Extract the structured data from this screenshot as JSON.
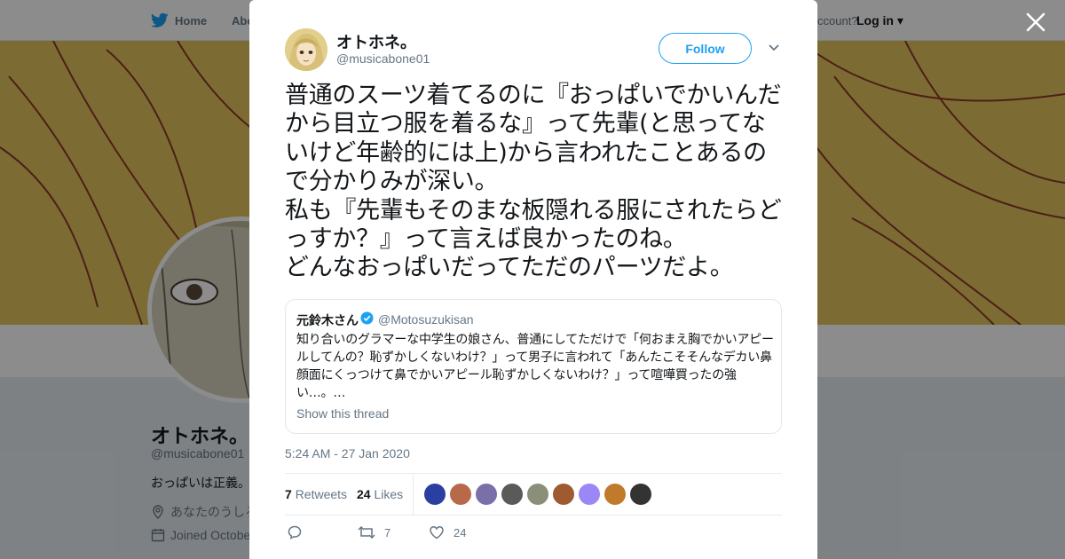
{
  "background_page": {
    "nav": {
      "home": "Home",
      "about": "Abo",
      "account_prompt": "ccount?",
      "login": "Log in"
    },
    "profile": {
      "name": "オトホネ。",
      "handle": "@musicabone01",
      "bio": "おっぱいは正義。",
      "location": "あなたのうしろ",
      "joined": "Joined Octobe"
    }
  },
  "tweet": {
    "author_name": "オトホネ。",
    "author_handle": "@musicabone01",
    "follow_label": "Follow",
    "text": "普通のスーツ着てるのに『おっぱいでかいんだから目立つ服を着るな』って先輩(と思ってないけど年齢的には上)から言われたことあるので分かりみが深い。\n私も『先輩もそのまな板隠れる服にされたらどっすか？』って言えば良かったのね。\nどんなおっぱいだってただのパーツだよ。",
    "quote": {
      "name": "元鈴木さん",
      "handle": "@Motosuzukisan",
      "text": "知り合いのグラマーな中学生の娘さん、普通にしてただけで「何おまえ胸でかいアピールしてんの？恥ずかしくないわけ？」って男子に言われて「あんたこそそんなデカい鼻顔面にくっつけて鼻でかいアピール恥ずかしくないわけ？」って喧嘩買ったの強い…。…",
      "show_thread": "Show this thread"
    },
    "timestamp": "5:24 AM - 27 Jan 2020",
    "retweets_count": "7",
    "retweets_label": "Retweets",
    "likes_count": "24",
    "likes_label": "Likes",
    "likers": [
      "#2b3fa0",
      "#b8694a",
      "#7a6fa8",
      "#5a5a5a",
      "#8a8f7a",
      "#a05a30",
      "#9b87f5",
      "#c07a2a",
      "#333333"
    ],
    "action_retweet_count": "7",
    "action_like_count": "24"
  },
  "colors": {
    "accent": "#1da1f2",
    "muted": "#657786",
    "banner": "#e3c460"
  }
}
